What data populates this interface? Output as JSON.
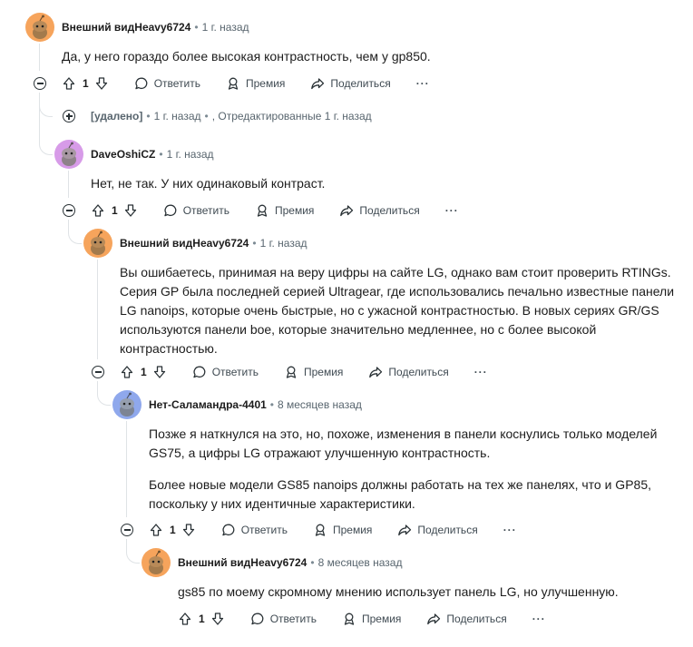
{
  "actions": {
    "reply": "Ответить",
    "award": "Премия",
    "share": "Поделиться",
    "more": "···"
  },
  "comments": [
    {
      "author": "Внешний видHeavy6724",
      "time": "1 г. назад",
      "text": [
        "Да, у него гораздо более высокая контрастность, чем у gp850."
      ],
      "score": "1",
      "avatar_color": "#f6a45c"
    },
    {
      "deleted_label": "[удалено]",
      "time": "1 г. назад",
      "edited": ", Отредактированные 1 г. назад"
    },
    {
      "author": "DaveOshiCZ",
      "time": "1 г. назад",
      "text": [
        "Нет, не так. У них одинаковый контраст."
      ],
      "score": "1",
      "avatar_color": "#d79be8"
    },
    {
      "author": "Внешний видHeavy6724",
      "time": "1 г. назад",
      "text": [
        "Вы ошибаетесь, принимая на веру цифры на сайте LG, однако вам стоит проверить RTINGs. Серия GP была последней серией Ultragear, где использовались печально известные панели LG nanoips, которые очень быстрые, но с ужасной контрастностью. В новых сериях GR/GS используются панели boe, которые значительно медленнее, но с более высокой контрастностью."
      ],
      "score": "1",
      "avatar_color": "#f6a45c"
    },
    {
      "author": "Нет-Саламандра-4401",
      "time": "8 месяцев назад",
      "text": [
        "Позже я наткнулся на это, но, похоже, изменения в панели коснулись только моделей GS75, а цифры LG отражают улучшенную контрастность.",
        "Более новые модели GS85 nanoips должны работать на тех же панелях, что и GP85, поскольку у них идентичные характеристики."
      ],
      "score": "1",
      "avatar_color": "#8fa8ec"
    },
    {
      "author": "Внешний видHeavy6724",
      "time": "8 месяцев назад",
      "text": [
        "gs85 по моему скромному мнению использует панель LG, но улучшенную."
      ],
      "score": "1",
      "avatar_color": "#f6a45c"
    }
  ]
}
